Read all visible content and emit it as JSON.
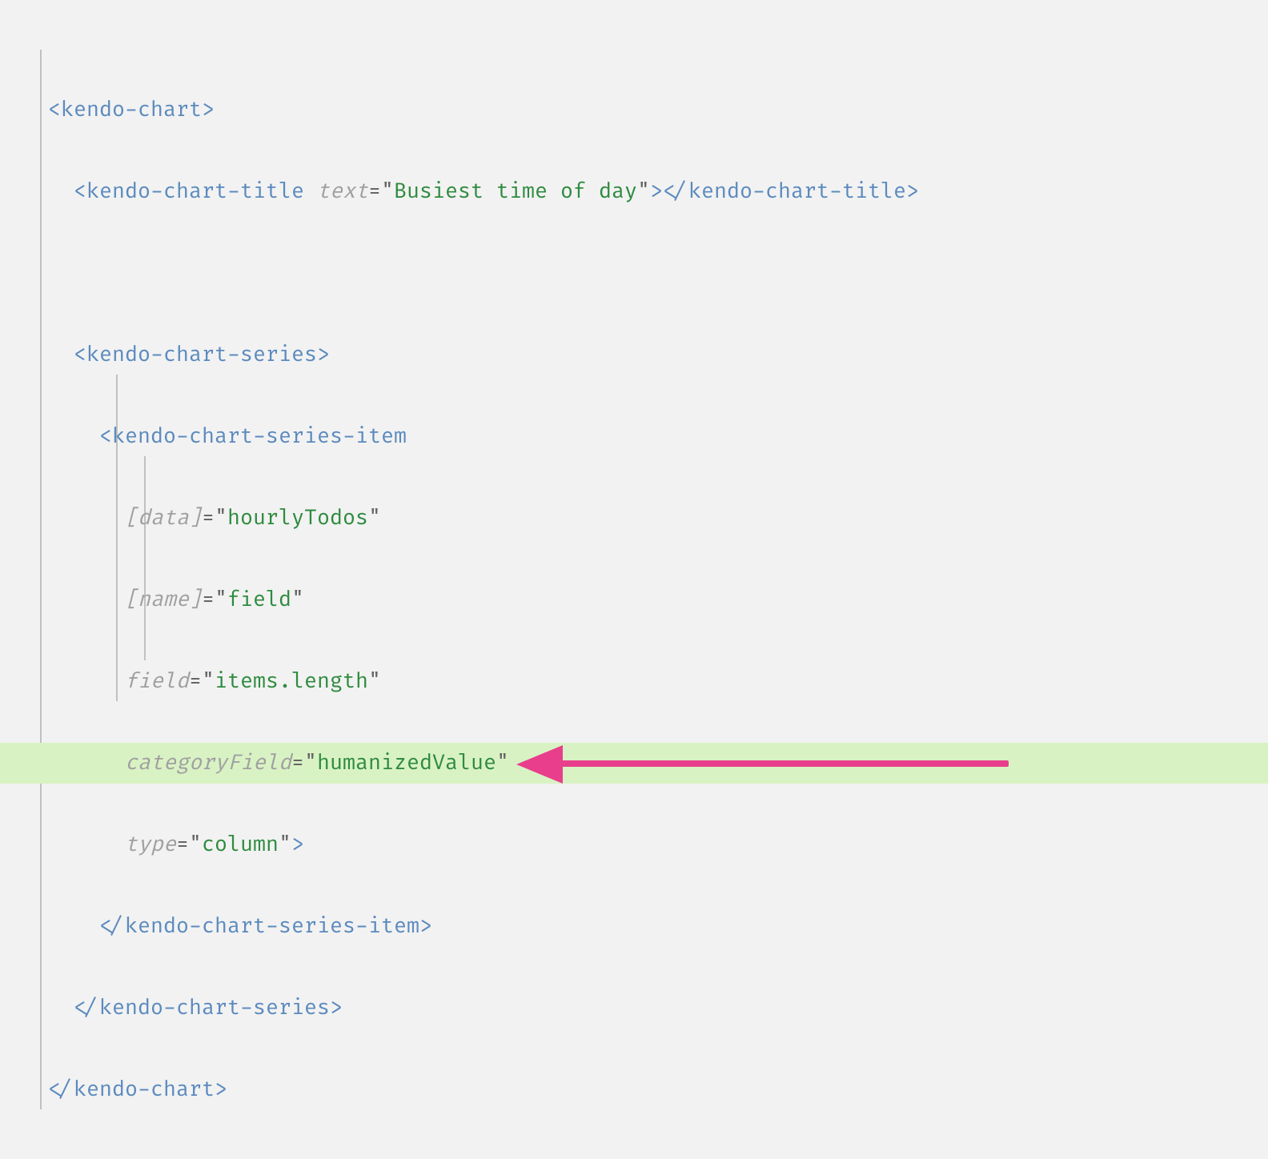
{
  "tags": {
    "chart": "kendo-chart",
    "title": "kendo-chart-title",
    "series": "kendo-chart-series",
    "seriesItem": "kendo-chart-series-item"
  },
  "attrs": {
    "text": "text",
    "data": "[data]",
    "name": "[name]",
    "field": "field",
    "categoryField": "categoryField",
    "type": "type"
  },
  "values": {
    "text": "Busiest time of day",
    "data": "hourlyTodos",
    "name": "field",
    "field": "items.length",
    "categoryField": "humanizedValue",
    "type": "column"
  },
  "punct": {
    "lt": "<",
    "gt": ">",
    "slash": "/",
    "eq": "=",
    "q": "\""
  },
  "annotation": {
    "arrow_points_to": "categoryField attribute line",
    "arrow_color": "#e83e8c",
    "highlight_color": "#d9f2c4"
  }
}
